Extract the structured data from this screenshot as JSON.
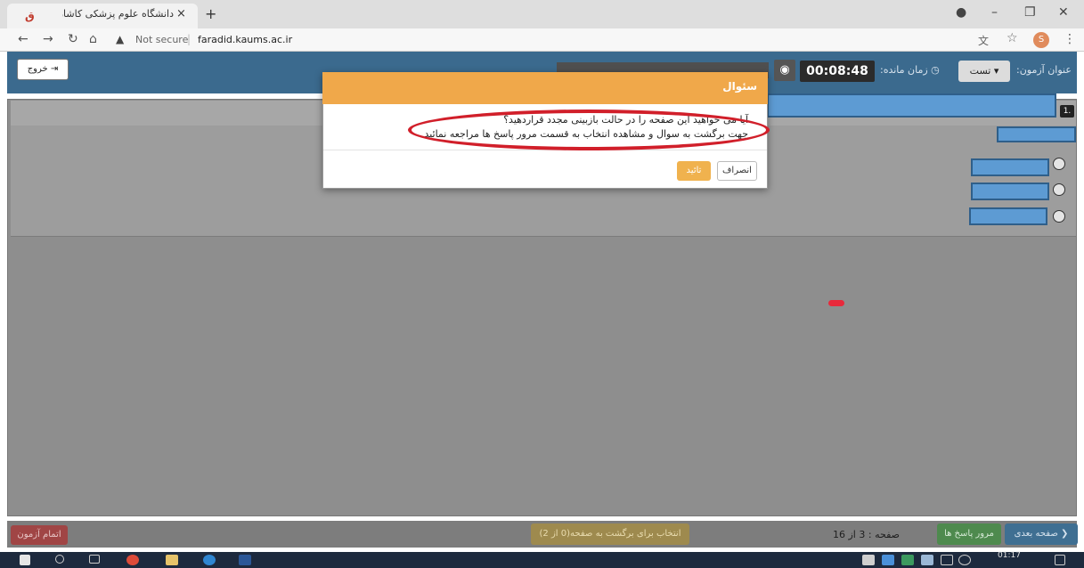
{
  "browser": {
    "tab_title": "دانشگاه علوم پزشکی کاشان",
    "tab_close": "×",
    "new_tab": "+",
    "url_not_secure": "Not secure",
    "url_separator": "|",
    "url_host": "faradid.kaums.ac.ir",
    "profile_initial": "S"
  },
  "header": {
    "exit_label": "خروج",
    "exam_title_label": "عنوان آزمون:",
    "exam_name": "تست",
    "remaining_label": "زمان مانده:",
    "timer": "00:08:48"
  },
  "modal": {
    "title": "سئوال",
    "line1": "آیا می خواهید این صفحه را در حالت بازبینی مجدد قراردهید؟",
    "line2": "جهت برگشت به سوال و مشاهده انتخاب به قسمت مرور پاسخ ها مراجعه نمائید",
    "cancel_label": "انصراف",
    "confirm_label": "تائید"
  },
  "question": {
    "number": "1."
  },
  "footer": {
    "finish_label": "اتمام آزمون",
    "back_select_label": "انتخاب برای برگشت به صفحه(0 از 2)",
    "page_info": "صفحه : 3 از 16",
    "review_label": "مرور پاسخ ها",
    "next_label": "صفحه بعدی"
  },
  "taskbar": {
    "time": "01:17"
  },
  "colors": {
    "topbar": "#3b6a8e",
    "modal_header": "#f0a84a",
    "highlight": "#d11f2a",
    "redaction": "#5d9bd3"
  }
}
